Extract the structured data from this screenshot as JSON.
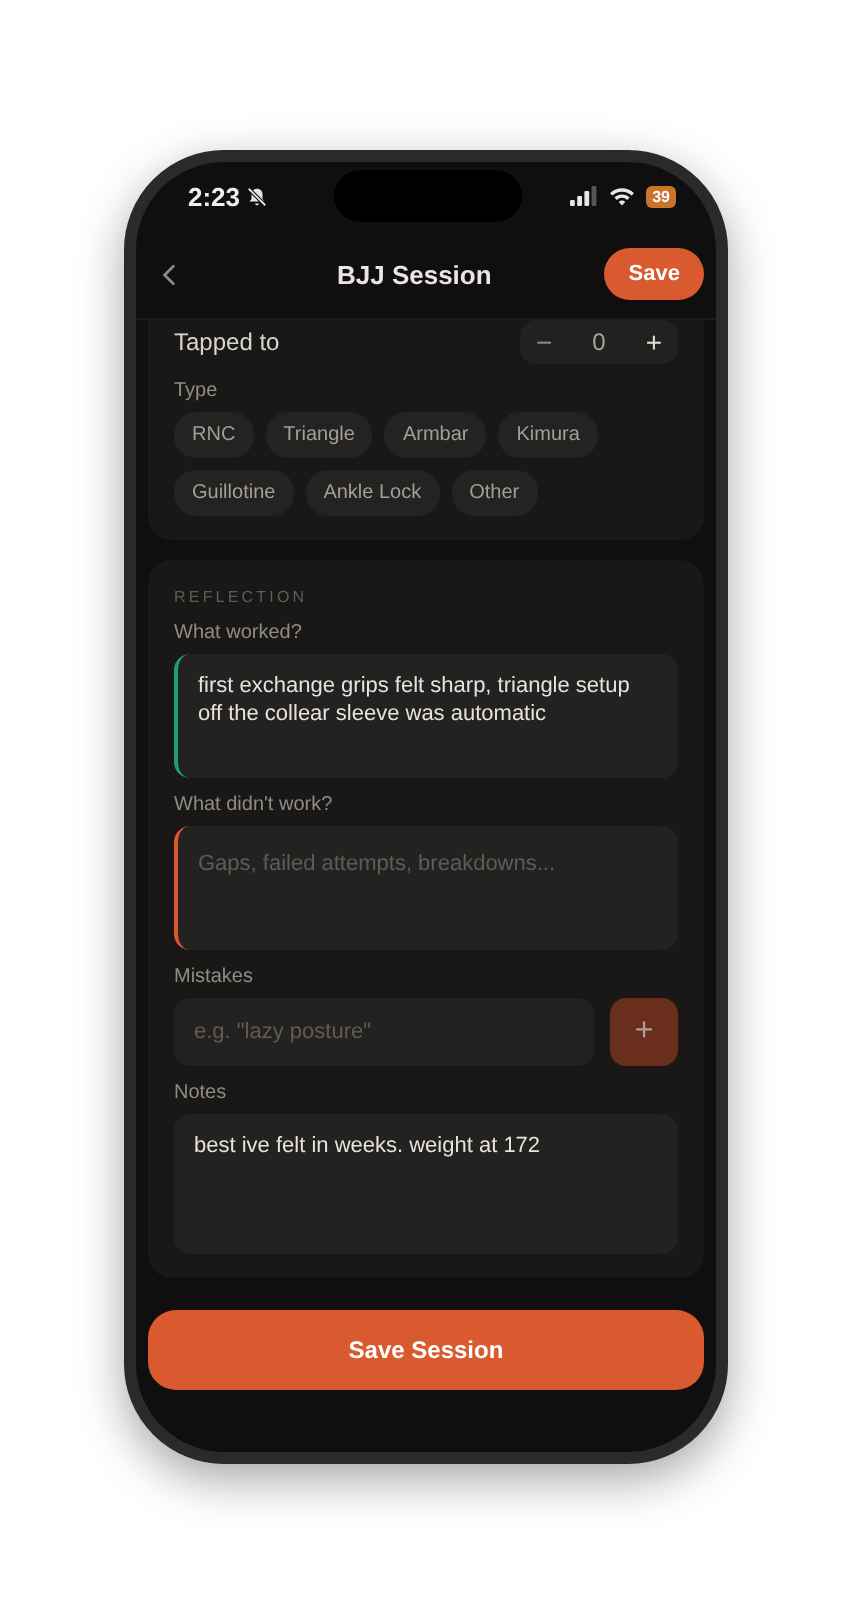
{
  "status_bar": {
    "time": "2:23",
    "battery": "39"
  },
  "nav": {
    "title": "BJJ Session",
    "action": "Save"
  },
  "tapped_to": {
    "label": "Tapped to",
    "minus": "−",
    "value": "0",
    "plus": "+"
  },
  "type": {
    "label": "Type",
    "chips": [
      {
        "label": "RNC",
        "selected": false
      },
      {
        "label": "Triangle",
        "selected": false
      },
      {
        "label": "Armbar",
        "selected": false
      },
      {
        "label": "Kimura",
        "selected": false
      },
      {
        "label": "Guillotine",
        "selected": false
      },
      {
        "label": "Ankle Lock",
        "selected": false
      },
      {
        "label": "Other",
        "selected": false
      }
    ]
  },
  "reflection": {
    "heading": "REFLECTION",
    "fields": [
      {
        "label": "What worked?",
        "value": "first exchange grips felt sharp, triangle setup off the collear sleeve was automatic",
        "color": "#1f9e74"
      },
      {
        "label": "What didn't work?",
        "placeholder": "Gaps, failed attempts, breakdowns...",
        "color": "#d9582f"
      }
    ],
    "mistakes": {
      "label": "Mistakes",
      "placeholder": "e.g. \"lazy posture\"",
      "add": "+"
    },
    "notes": {
      "label": "Notes",
      "value": "best ive felt in weeks. weight at 172"
    }
  },
  "save_button": "Save Session"
}
